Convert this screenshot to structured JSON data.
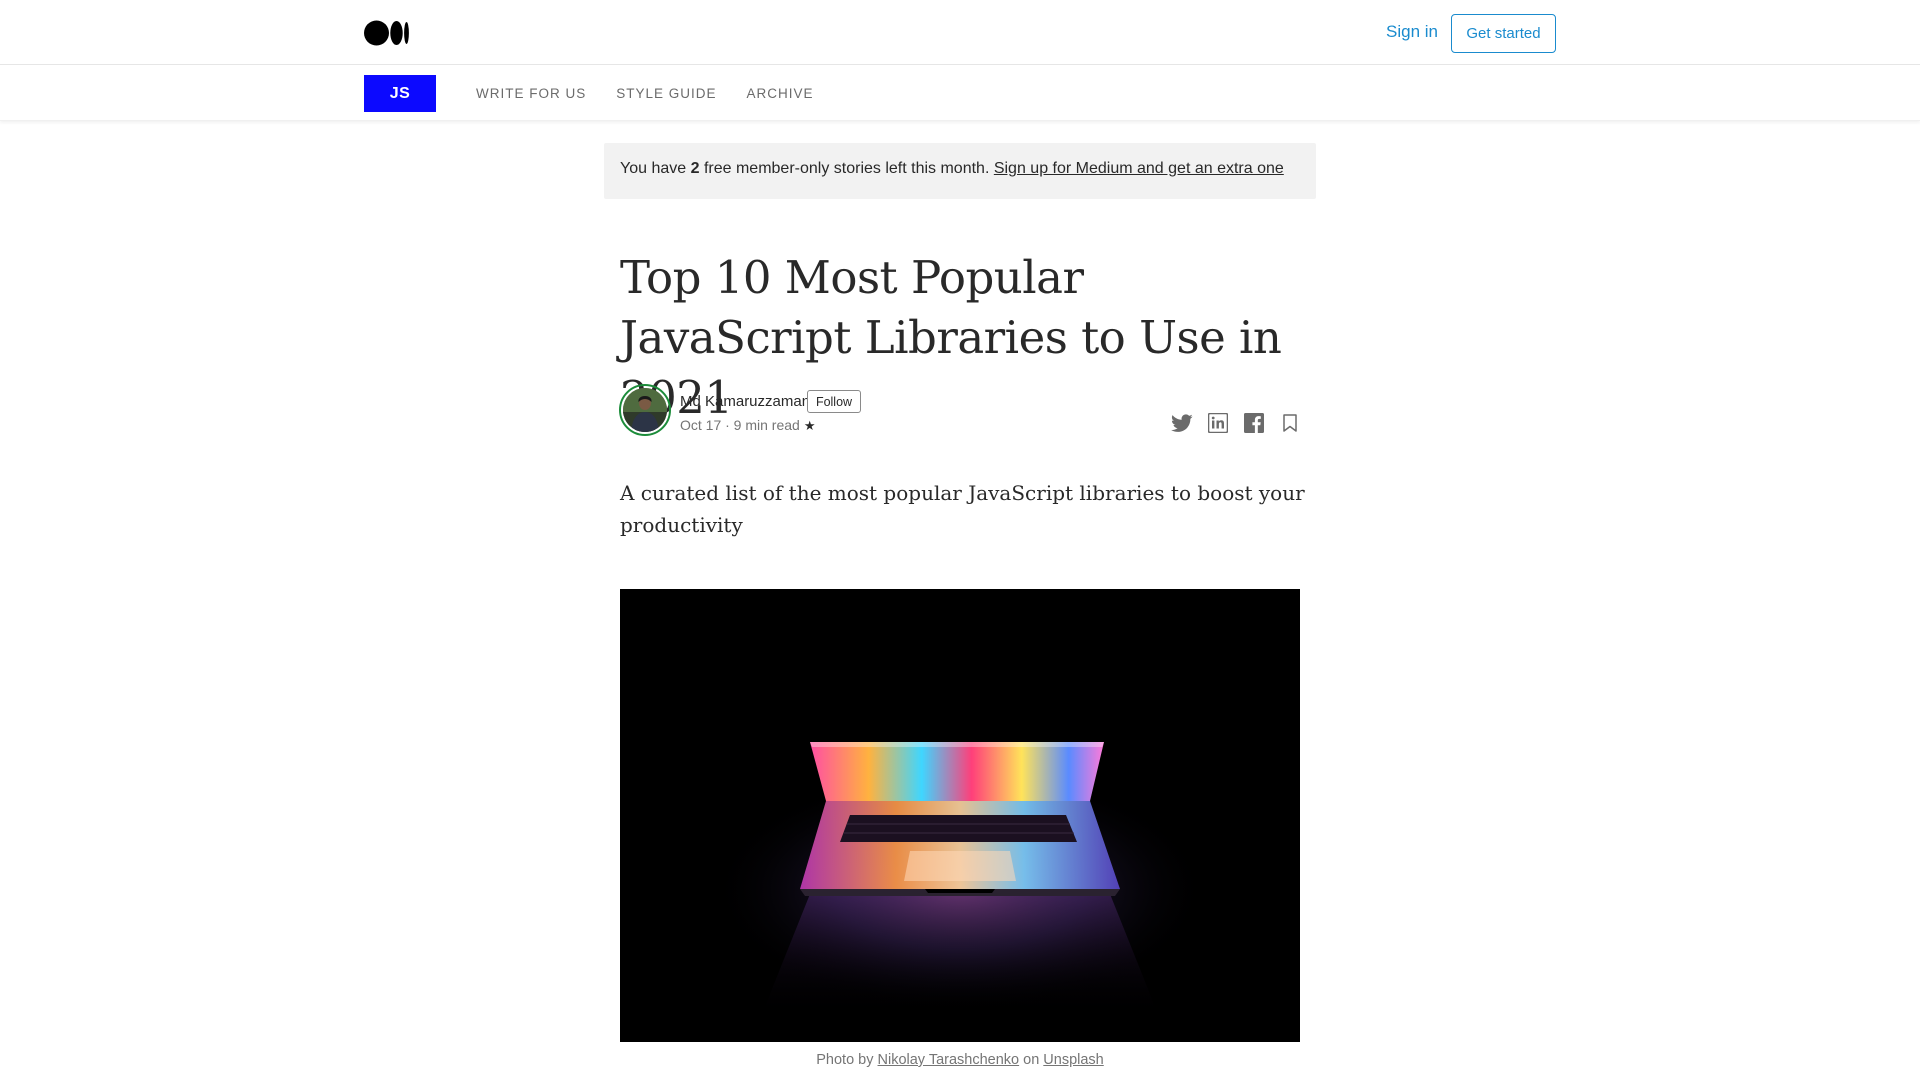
{
  "header": {
    "logo_icon": "medium-logo-icon",
    "signin_label": "Sign in",
    "getstarted_label": "Get started",
    "accent_color": "#1a8bce"
  },
  "publication": {
    "logo_text": "JS",
    "logo_color": "#0c09ff",
    "nav": [
      "WRITE FOR US",
      "STYLE GUIDE",
      "ARCHIVE"
    ]
  },
  "banner": {
    "prefix": "You have ",
    "count": "2",
    "middle": " free member-only stories left this month. ",
    "link": "Sign up for Medium and get an extra one"
  },
  "article": {
    "title": "Top 10 Most Popular JavaScript Libraries to Use in 2021",
    "author": "Md Kamaruzzaman",
    "follow_label": "Follow",
    "date_readtime": "Oct 17 · 9 min read",
    "member_star": "★",
    "subtitle": "A curated list of the most popular JavaScript libraries to boost your productivity",
    "share_icons": [
      "twitter-icon",
      "linkedin-icon",
      "facebook-icon",
      "bookmark-icon"
    ]
  },
  "caption": {
    "prefix": "Photo by ",
    "photographer": "Nikolay Tarashchenko",
    "middle": " on ",
    "source": "Unsplash"
  }
}
